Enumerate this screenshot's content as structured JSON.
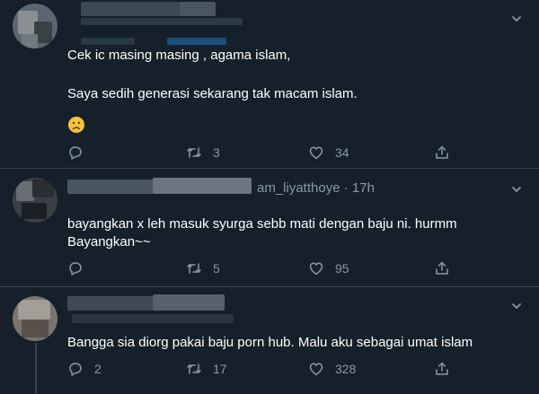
{
  "tweets": [
    {
      "handle_time": "",
      "lines": [
        "Cek ic masing masing , agama islam,",
        "Saya sedih generasi sekarang tak macam islam."
      ],
      "emoji": "frowning-face-emoji",
      "reply_count": "",
      "retweet_count": "3",
      "like_count": "34"
    },
    {
      "handle_time": "am_liyatthoye · 17h",
      "lines": [
        "bayangkan x leh masuk syurga sebb mati dengan baju ni. hurmm",
        "Bayangkan~~"
      ],
      "reply_count": "",
      "retweet_count": "5",
      "like_count": "95"
    },
    {
      "handle_time": "",
      "lines": [
        "Bangga sia diorg pakai baju porn hub. Malu aku sebagai umat islam"
      ],
      "reply_count": "2",
      "retweet_count": "17",
      "like_count": "328"
    }
  ],
  "colors": {
    "background": "#15202b",
    "divider": "#38444d",
    "muted": "#8899a6",
    "text": "#ffffff",
    "emoji": "#f5c33b"
  }
}
